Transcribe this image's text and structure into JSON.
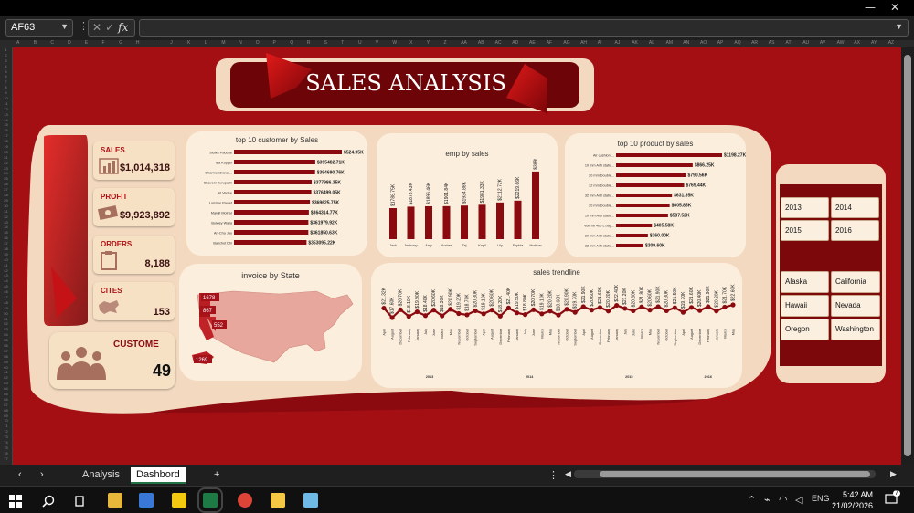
{
  "window": {
    "minimize": "—",
    "close": "✕"
  },
  "formula_bar": {
    "name_box": "AF63",
    "cancel": "✕",
    "enter": "✓",
    "fx": "fx",
    "formula": ""
  },
  "dashboard": {
    "title": "SALES ANALYSIS",
    "kpis": {
      "sales": {
        "label": "SALES",
        "value": "$1,014,318",
        "icon": "bar-chart-icon"
      },
      "profit": {
        "label": "PROFIT",
        "value": "$9,923,892",
        "icon": "money-icon"
      },
      "orders": {
        "label": "ORDERS",
        "value": "8,188",
        "icon": "clipboard-icon"
      },
      "cites": {
        "label": "CITES",
        "value": "153",
        "icon": "map-icon"
      },
      "customers": {
        "label": "CUSTOME",
        "value": "49",
        "icon": "people-icon"
      }
    },
    "slicer_years": {
      "items": [
        "2013",
        "2014",
        "2015",
        "2016"
      ]
    },
    "slicer_states": {
      "items": [
        "Alaska",
        "California",
        "Hawaii",
        "Nevada",
        "Oregon",
        "Washington"
      ]
    }
  },
  "chart_data": [
    {
      "type": "bar",
      "orientation": "horizontal",
      "title": "top 10 customer by Sales",
      "categories": [
        "Slutke Padone",
        "Tea Koppel",
        "Dharmendranat...",
        "Bhaveni Kurupathi",
        "Ari Vadee",
        "Lonsine Paulet",
        "Margit Molnar",
        "Bulwey Walia",
        "An-Chu Jao",
        "Banchut Dhi"
      ],
      "values": [
        524950,
        395482.71,
        394690.76,
        377986.35,
        376499.05,
        369625.75,
        364314.77,
        361979.92,
        361850.63,
        353095.22
      ],
      "labels": [
        "$524.95K",
        "$395482.71K",
        "$394690.76K",
        "$377986.35K",
        "$376499.05K",
        "$369625.75K",
        "$364314.77K",
        "$361979.92K",
        "$361850.63K",
        "$353095.22K"
      ]
    },
    {
      "type": "bar",
      "title": "emp by sales",
      "categories": [
        "Jack",
        "Anthony",
        "Amy",
        "Archer",
        "Taj",
        "Kapil",
        "Lily",
        "Sophia",
        "Hudson"
      ],
      "values": [
        1788.75,
        1873.43,
        1896.46,
        1901.84,
        1934.88,
        1981.33,
        2112.72,
        2219.66,
        3899.22
      ],
      "labels": [
        "$1788.75K",
        "$1873.43K",
        "$1896.46K",
        "$1901.84K",
        "$1934.88K",
        "$1981.33K",
        "$2112.72K",
        "$2219.66K",
        "$3899.22K"
      ]
    },
    {
      "type": "bar",
      "orientation": "horizontal",
      "title": "top 10 product by sales",
      "categories": [
        "Air cushion ...",
        "10 mm Anti static...",
        "20 mm Double...",
        "32 mm Double...",
        "32 mm Anti static...",
        "20 mm Double...",
        "10 mm Anti static...",
        "Void fill 400 L bag...",
        "20 mm Anti static...",
        "32 mm Anti static..."
      ],
      "values": [
        1198.27,
        866.25,
        790.56,
        769.44,
        631.85,
        605.85,
        587.52,
        405.58,
        360,
        309.6
      ],
      "labels": [
        "$1198.27K",
        "$866.25K",
        "$790.56K",
        "$769.44K",
        "$631.85K",
        "$605.85K",
        "$587.52K",
        "$405.58K",
        "$360.00K",
        "$309.60K"
      ]
    },
    {
      "type": "map",
      "title": "invoice by State",
      "labels": [
        "1678",
        "867",
        "552",
        "1269"
      ]
    },
    {
      "type": "line",
      "title": "sales trendline",
      "x": [
        "April",
        "August",
        "December",
        "February",
        "January",
        "July",
        "June",
        "March",
        "May",
        "November",
        "October",
        "September",
        "April",
        "August",
        "December",
        "February",
        "January",
        "July",
        "June",
        "March",
        "May",
        "November",
        "October",
        "September",
        "April",
        "August",
        "December",
        "February",
        "January",
        "July",
        "June",
        "March",
        "May",
        "November",
        "October",
        "September",
        "April",
        "August",
        "December",
        "February",
        "January",
        "March",
        "May"
      ],
      "year_groups": [
        {
          "year": "2013",
          "count": 12
        },
        {
          "year": "2014",
          "count": 12
        },
        {
          "year": "2015",
          "count": 12
        },
        {
          "year": "2016",
          "count": 7
        }
      ],
      "values": [
        21.32,
        17.6,
        20.7,
        18.1,
        19.9,
        18.4,
        20.6,
        18.3,
        20.9,
        19.2,
        18.7,
        20.3,
        19.1,
        20.6,
        18.2,
        21.4,
        19.5,
        18.8,
        20.7,
        19.1,
        20.2,
        18.6,
        20.9,
        19.7,
        21.9,
        20.6,
        21.6,
        20.2,
        22.4,
        21.2,
        20.3,
        21.8,
        20.6,
        21.9,
        20.3,
        21.5,
        19.7,
        21.6,
        20.4,
        21.9,
        20.2,
        21.7,
        22.6
      ]
    }
  ],
  "sheet_tabs": {
    "tab1": "Analysis",
    "tab2": "Dashbord",
    "add": "+"
  },
  "taskbar": {
    "time": "5:42 AM",
    "date": "21/02/2026",
    "lang": "ENG",
    "notif": "7"
  }
}
